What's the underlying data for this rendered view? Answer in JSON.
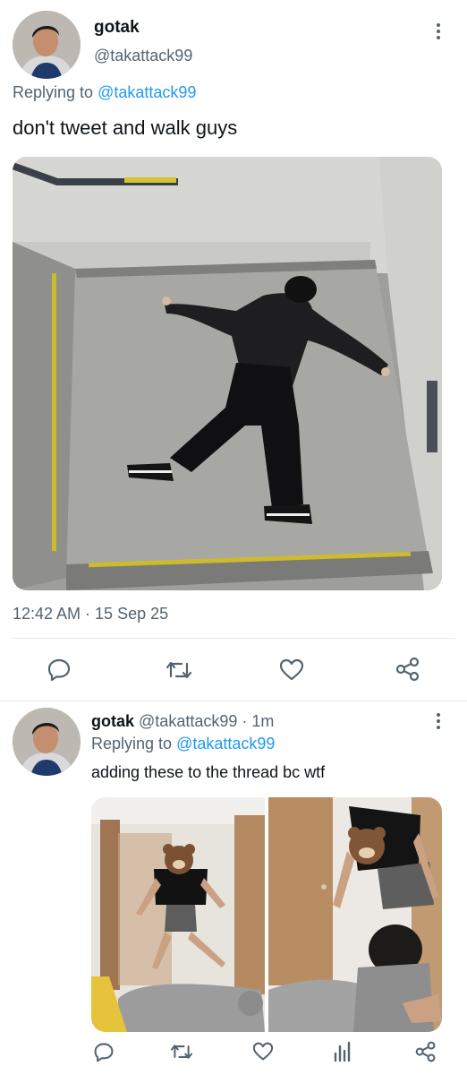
{
  "tweet1": {
    "display_name": "gotak",
    "handle": "@takattack99",
    "replying_prefix": "Replying to ",
    "replying_handle": "@takattack99",
    "text": "don't tweet and walk guys",
    "timestamp": "12:42 AM · 15 Sep 25",
    "media": "photo-person-lying-on-stair-landing"
  },
  "tweet2": {
    "display_name": "gotak",
    "handle_time": "@takattack99 · 1m",
    "replying_prefix": "Replying to ",
    "replying_handle": "@takattack99",
    "text": "adding these to the thread bc wtf",
    "media": [
      "photo-person-with-bear-shirt-jumping",
      "photo-person-with-bear-shirt-falling"
    ]
  },
  "actions": [
    "reply-icon",
    "retweet-icon",
    "like-icon",
    "share-icon"
  ],
  "actions_row2": [
    "reply-icon",
    "retweet-icon",
    "like-icon",
    "views-icon",
    "share-icon"
  ],
  "colors": {
    "accent": "#1d9bf0",
    "muted": "#536471",
    "divider": "#e6e9eb"
  }
}
